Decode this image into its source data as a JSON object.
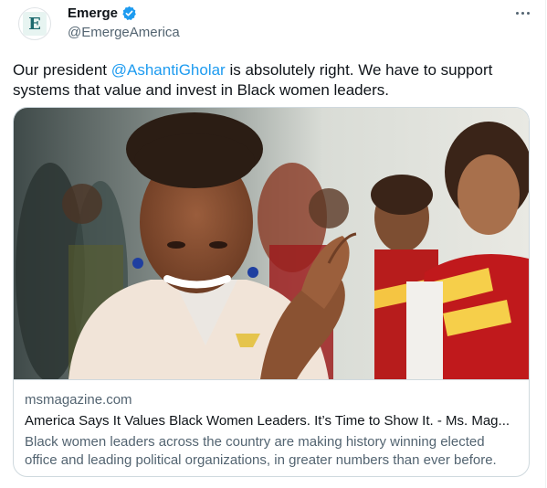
{
  "tweet": {
    "avatar_letter": "E",
    "display_name": "Emerge",
    "handle": "@EmergeAmerica",
    "text_before": "Our president ",
    "mention": "@AshantiGholar",
    "text_after": " is absolutely right. We have to support systems that value and invest in Black women leaders."
  },
  "card": {
    "image_icon": "photo-woman-clapping-with-cheerleaders",
    "domain": "msmagazine.com",
    "title": "America Says It Values Black Women Leaders. It’s Time to Show It. - Ms. Mag...",
    "description": "Black women leaders across the country are making history winning elected office and leading political organizations, in greater numbers than ever before."
  },
  "colors": {
    "link": "#1d9bf0",
    "verified": "#1d9bf0",
    "text": "#0f1419",
    "muted": "#536471",
    "border": "#cfd9de"
  }
}
